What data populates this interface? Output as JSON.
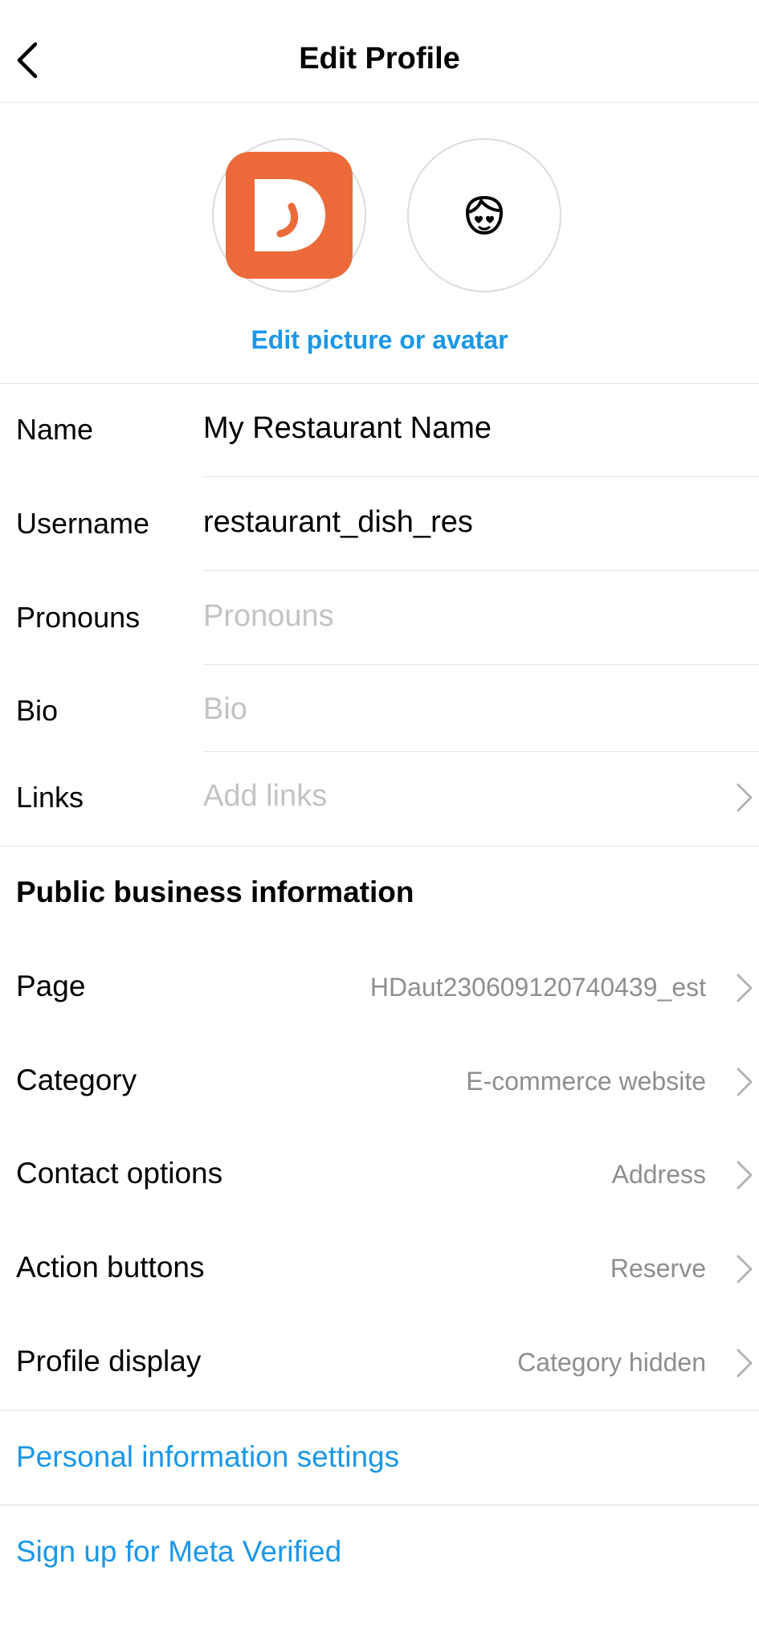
{
  "header": {
    "title": "Edit Profile"
  },
  "avatar": {
    "edit_link": "Edit picture or avatar"
  },
  "form": {
    "name_label": "Name",
    "name_value": "My Restaurant Name",
    "username_label": "Username",
    "username_value": "restaurant_dish_res",
    "pronouns_label": "Pronouns",
    "pronouns_placeholder": "Pronouns",
    "bio_label": "Bio",
    "bio_placeholder": "Bio",
    "links_label": "Links",
    "links_placeholder": "Add links"
  },
  "business": {
    "section_title": "Public business information",
    "rows": [
      {
        "label": "Page",
        "value": "HDaut230609120740439_est"
      },
      {
        "label": "Category",
        "value": "E-commerce website"
      },
      {
        "label": "Contact options",
        "value": "Address"
      },
      {
        "label": "Action buttons",
        "value": "Reserve"
      },
      {
        "label": "Profile display",
        "value": "Category hidden"
      }
    ]
  },
  "links": {
    "personal_info": "Personal information settings",
    "meta_verified": "Sign up for Meta Verified"
  },
  "colors": {
    "accent": "#1a97e8",
    "logo": "#ec6a3a"
  }
}
